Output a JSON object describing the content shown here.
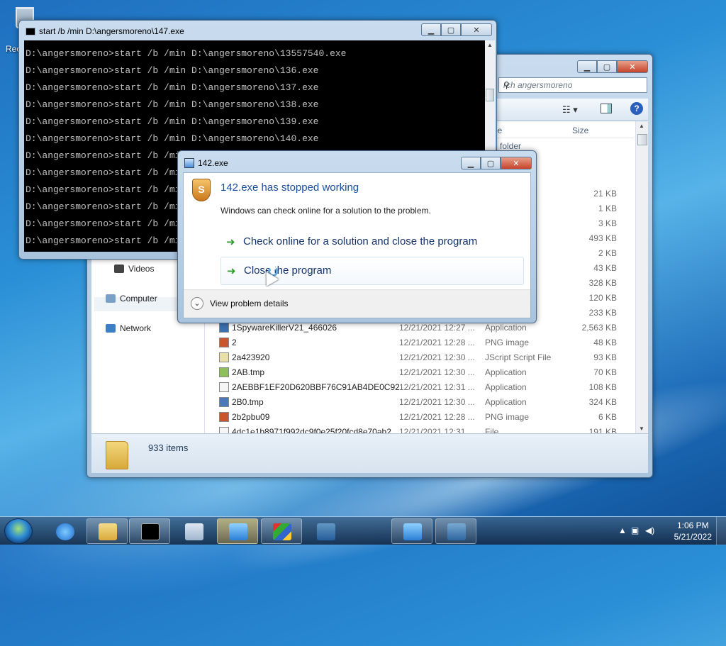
{
  "desktop": {
    "recycle_label": "Rec"
  },
  "explorer": {
    "search_placeholder": "rch angersmoreno",
    "columns": {
      "type": "pe",
      "size": "Size"
    },
    "partial_type": "e folder",
    "nav": [
      {
        "label": "Videos"
      },
      {
        "label": "Computer"
      },
      {
        "label": "Network"
      }
    ],
    "rows": [
      {
        "name": "",
        "date": "",
        "type": "",
        "size": "21 KB"
      },
      {
        "name": "",
        "date": "",
        "type": "",
        "size": "1 KB"
      },
      {
        "name": "",
        "date": "",
        "type": "",
        "size": "3 KB"
      },
      {
        "name": "",
        "date": "",
        "type": "",
        "size": "493 KB"
      },
      {
        "name": "",
        "date": "",
        "type": "",
        "size": "2 KB"
      },
      {
        "name": "",
        "date": "",
        "type": "",
        "size": "43 KB"
      },
      {
        "name": "",
        "date": "",
        "type": "",
        "size": "328 KB"
      },
      {
        "name": "",
        "date": "",
        "type": "",
        "size": "120 KB"
      },
      {
        "name": "",
        "date": "",
        "type": "",
        "size": "233 KB"
      },
      {
        "name": "1SpywareKillerV21_466026",
        "date": "12/21/2021 12:27 ...",
        "type": "Application",
        "size": "2,563 KB"
      },
      {
        "name": "2",
        "date": "12/21/2021 12:28 ...",
        "type": "PNG image",
        "size": "48 KB"
      },
      {
        "name": "2a423920",
        "date": "12/21/2021 12:30 ...",
        "type": "JScript Script File",
        "size": "93 KB"
      },
      {
        "name": "2AB.tmp",
        "date": "12/21/2021 12:30 ...",
        "type": "Application",
        "size": "70 KB"
      },
      {
        "name": "2AEBBF1EF20D620BBF76C91AB4DE0C92",
        "date": "12/21/2021 12:31 ...",
        "type": "Application",
        "size": "108 KB"
      },
      {
        "name": "2B0.tmp",
        "date": "12/21/2021 12:30 ...",
        "type": "Application",
        "size": "324 KB"
      },
      {
        "name": "2b2pbu09",
        "date": "12/21/2021 12:28 ...",
        "type": "PNG image",
        "size": "6 KB"
      },
      {
        "name": "4dc1e1b8971f992dc9f0e25f20fcd8e70ab2",
        "date": "12/21/2021 12:31 ...",
        "type": "File",
        "size": "191 KB"
      }
    ],
    "status": {
      "count": "933 items"
    }
  },
  "cmd": {
    "title": "start  /b /min D:\\angersmoreno\\147.exe",
    "lines": [
      "D:\\angersmoreno>start /b /min D:\\angersmoreno\\13557540.exe",
      "D:\\angersmoreno>start /b /min D:\\angersmoreno\\136.exe",
      "D:\\angersmoreno>start /b /min D:\\angersmoreno\\137.exe",
      "D:\\angersmoreno>start /b /min D:\\angersmoreno\\138.exe",
      "D:\\angersmoreno>start /b /min D:\\angersmoreno\\139.exe",
      "D:\\angersmoreno>start /b /min D:\\angersmoreno\\140.exe",
      "D:\\angersmoreno>start /b /mi",
      "D:\\angersmoreno>start /b /mi",
      "D:\\angersmoreno>start /b /mi",
      "D:\\angersmoreno>start /b /mi",
      "D:\\angersmoreno>start /b /mi",
      "D:\\angersmoreno>start /b /mi"
    ]
  },
  "dialog": {
    "title": "142.exe",
    "heading": "142.exe has stopped working",
    "subtext": "Windows can check online for a solution to the problem.",
    "option_check": "Check online for a solution and close the program",
    "option_close": "Close the program",
    "details": "View problem details"
  },
  "taskbar": {
    "clock_time": "1:06 PM",
    "clock_date": "5/21/2022"
  }
}
